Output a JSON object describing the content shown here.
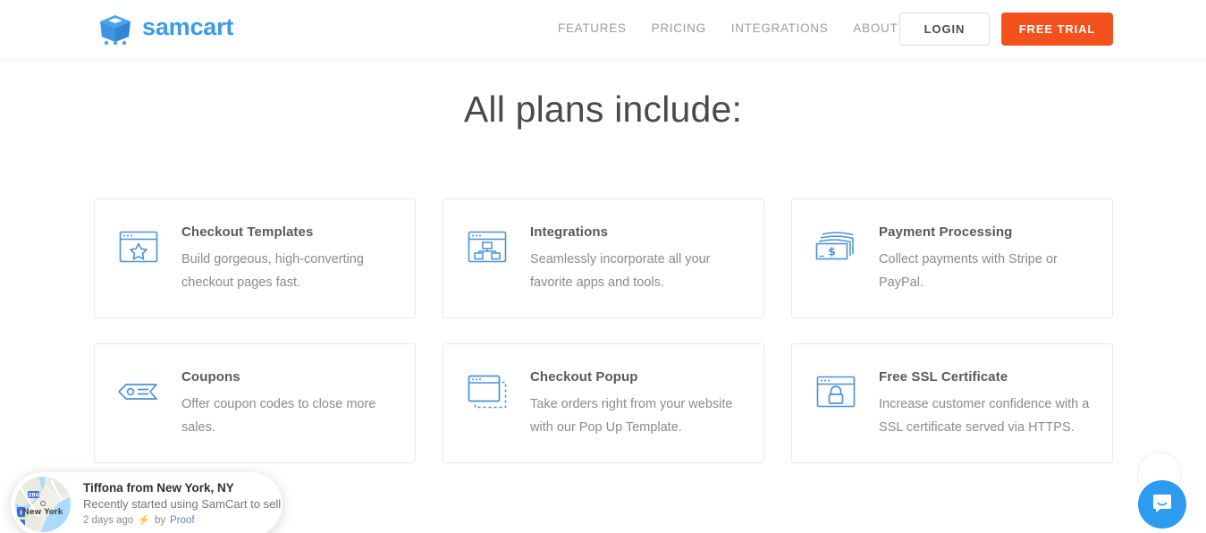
{
  "header": {
    "logo_text": "samcart",
    "logo_icon": "samcart-cart-logo",
    "nav": [
      {
        "label": "FEATURES",
        "has_caret": false
      },
      {
        "label": "PRICING",
        "has_caret": false
      },
      {
        "label": "INTEGRATIONS",
        "has_caret": false
      },
      {
        "label": "ABOUT US",
        "has_caret": true
      }
    ],
    "login_label": "LOGIN",
    "trial_label": "FREE TRIAL",
    "accent_color": "#f4511e",
    "brand_color": "#3d9ae8"
  },
  "main": {
    "title": "All plans include:",
    "cards": [
      {
        "icon": "browser-star-icon",
        "title": "Checkout Templates",
        "desc": "Build gorgeous, high-converting checkout pages fast."
      },
      {
        "icon": "browser-sitemap-icon",
        "title": "Integrations",
        "desc": "Seamlessly incorporate all your favorite apps and tools."
      },
      {
        "icon": "money-bills-icon",
        "title": "Payment Processing",
        "desc": "Collect payments with Stripe or PayPal."
      },
      {
        "icon": "coupon-tag-icon",
        "title": "Coupons",
        "desc": "Offer coupon codes to close more sales."
      },
      {
        "icon": "browser-popup-icon",
        "title": "Checkout Popup",
        "desc": "Take orders right from your website with our Pop Up Template."
      },
      {
        "icon": "browser-lock-icon",
        "title": "Free SSL Certificate",
        "desc": "Increase customer confidence with a SSL certificate served via HTTPS."
      }
    ],
    "icon_color": "#4a90d9"
  },
  "proof_notification": {
    "avatar_icon": "map-thumbnail-new-york",
    "map_label": "New York",
    "name": "Tiffona from New York, NY",
    "subtitle": "Recently started using SamCart to sell ...",
    "time": "2 days ago",
    "bolt_icon": "lightning-bolt-icon",
    "by_label": "by",
    "brand": "Proof"
  },
  "chat_widget": {
    "icon": "intercom-chat-bubble-icon",
    "color": "#2d9bf0"
  }
}
